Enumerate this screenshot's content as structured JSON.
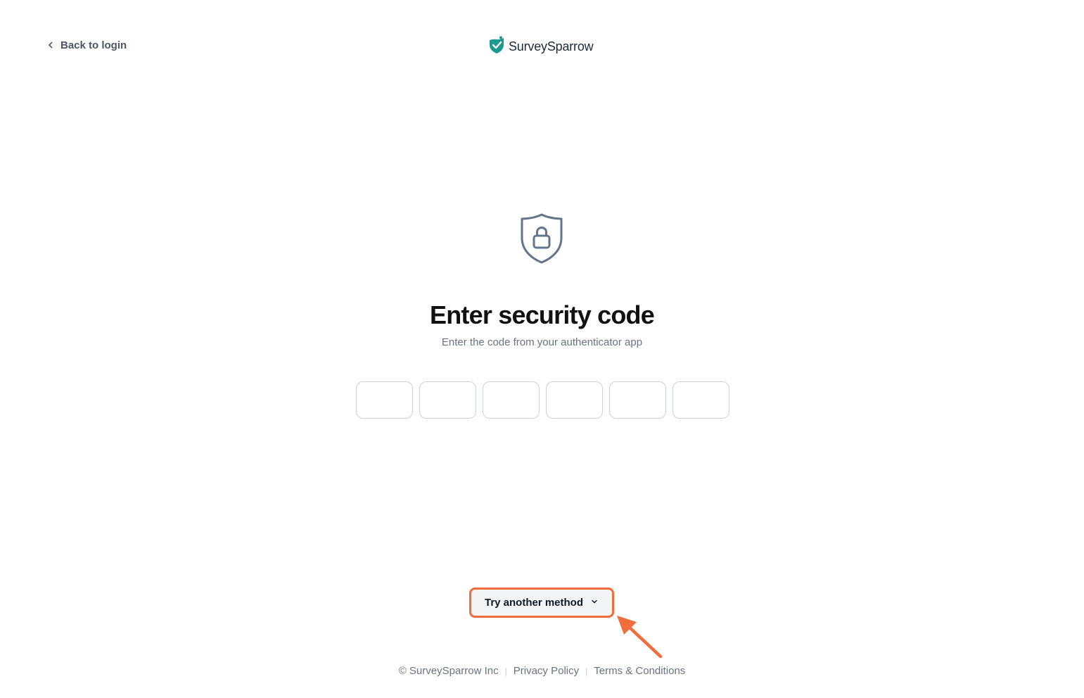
{
  "header": {
    "back_label": "Back to login",
    "brand_name": "SurveySparrow"
  },
  "main": {
    "title": "Enter security code",
    "subtitle": "Enter the code from your authenticator app",
    "code_digits": 6
  },
  "actions": {
    "try_another_label": "Try another method",
    "highlight_color": "#f26d3d"
  },
  "footer": {
    "copyright": "© SurveySparrow Inc",
    "privacy": "Privacy Policy",
    "terms": "Terms & Conditions"
  },
  "icons": {
    "back": "chevron-left-icon",
    "brand": "sparrow-logo-icon",
    "shield": "shield-lock-icon",
    "dropdown": "chevron-down-icon",
    "annotation": "arrow-annotation-icon"
  },
  "colors": {
    "brand_teal": "#1d9a8f",
    "shield_stroke": "#64748b",
    "text_dark": "#111111",
    "text_muted": "#6b7280"
  }
}
